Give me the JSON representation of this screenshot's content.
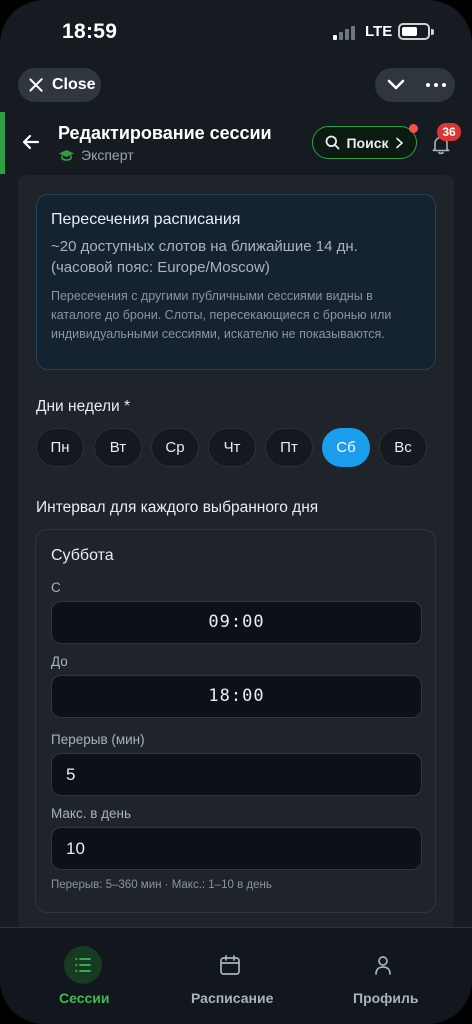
{
  "status_bar": {
    "time": "18:59",
    "network": "LTE"
  },
  "top_controls": {
    "close_label": "Close"
  },
  "header": {
    "title": "Редактирование сессии",
    "subtitle": "Эксперт",
    "search_label": "Поиск",
    "notification_count": "36",
    "accent_color": "#2ea043"
  },
  "info": {
    "title": "Пересечения расписания",
    "line1": "~20 доступных слотов на ближайшие 14 дн.",
    "line2": "(часовой пояс: Europe/Moscow)",
    "note": "Пересечения с другими публичными сессиями видны в каталоге до брони. Слоты, пересекающиеся с бронью или индивидуальными сессиями, искателю не показываются."
  },
  "weekdays": {
    "label": "Дни недели *",
    "days": [
      "Пн",
      "Вт",
      "Ср",
      "Чт",
      "Пт",
      "Сб",
      "Вс"
    ],
    "selected": "Сб",
    "selected_color": "#1a9dea"
  },
  "interval": {
    "label": "Интервал для каждого выбранного дня",
    "day_name": "Суббота",
    "from_label": "С",
    "from_value": "09:00",
    "to_label": "До",
    "to_value": "18:00",
    "break_label": "Перерыв (мин)",
    "break_value": "5",
    "max_label": "Макс. в день",
    "max_value": "10",
    "hint": "Перерыв: 5–360 мин · Макс.: 1–10 в день"
  },
  "bottom_nav": {
    "items": [
      {
        "label": "Сессии",
        "icon": "list-icon",
        "active": true
      },
      {
        "label": "Расписание",
        "icon": "calendar-icon",
        "active": false
      },
      {
        "label": "Профиль",
        "icon": "person-icon",
        "active": false
      }
    ],
    "active_color": "#3fb950"
  }
}
